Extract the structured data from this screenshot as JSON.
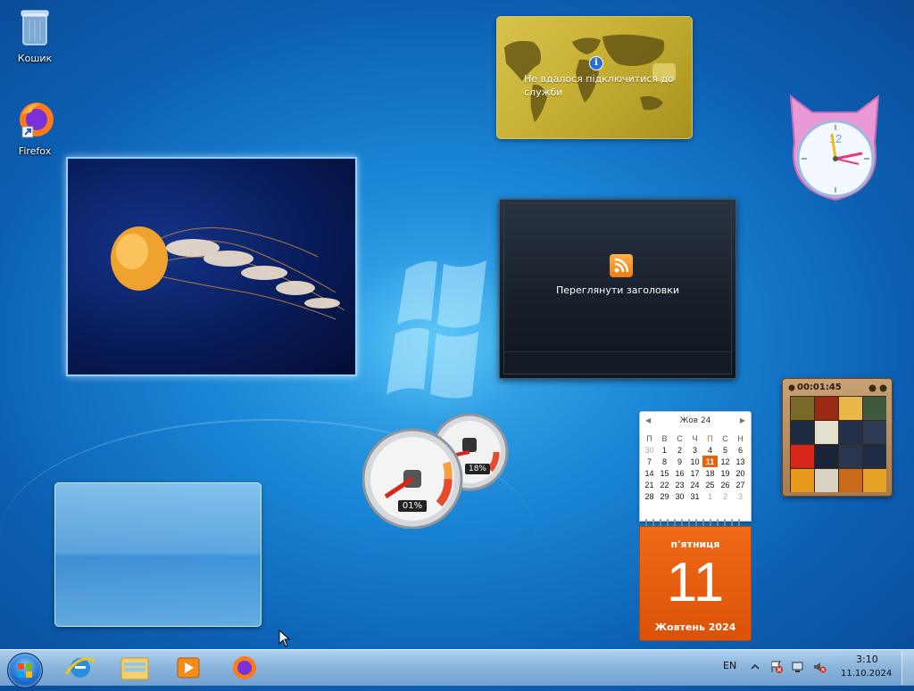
{
  "desktop": {
    "icons": [
      {
        "label": "Кошик"
      },
      {
        "label": "Firefox"
      }
    ]
  },
  "gadgets": {
    "currency": {
      "message": "Не вдалося підключитися до служби"
    },
    "feed": {
      "label": "Переглянути заголовки"
    },
    "meter": {
      "cpu": "01%",
      "memory": "18%"
    },
    "puzzle": {
      "time": "00:01:45"
    },
    "clock": {
      "numeral": "12"
    },
    "calendar": {
      "month_header": "Жов 24",
      "day_headers": [
        "П",
        "В",
        "С",
        "Ч",
        "П",
        "С",
        "Н"
      ],
      "weeks": [
        [
          "30",
          "1",
          "2",
          "3",
          "4",
          "5",
          "6"
        ],
        [
          "7",
          "8",
          "9",
          "10",
          "11",
          "12",
          "13"
        ],
        [
          "14",
          "15",
          "16",
          "17",
          "18",
          "19",
          "20"
        ],
        [
          "21",
          "22",
          "23",
          "24",
          "25",
          "26",
          "27"
        ],
        [
          "28",
          "29",
          "30",
          "31",
          "1",
          "2",
          "3"
        ]
      ],
      "weekday": "п'ятниця",
      "day": "11",
      "month_year": "Жовтень 2024"
    }
  },
  "taskbar": {
    "language": "EN",
    "time": "3:10",
    "date": "11.10.2024"
  },
  "colors": {
    "accent_orange": "#e4650f",
    "wallpaper_blue": "#1a86d6"
  }
}
